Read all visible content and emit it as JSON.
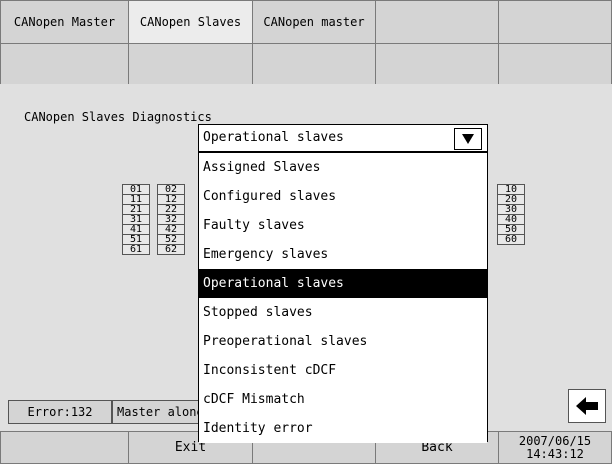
{
  "tabs": [
    {
      "label": "CANopen Master",
      "active": false
    },
    {
      "label": "CANopen Slaves",
      "active": true
    },
    {
      "label": "CANopen master",
      "active": false
    },
    {
      "label": "",
      "active": false
    },
    {
      "label": "",
      "active": false
    }
  ],
  "section_title": "CANopen Slaves Diagnostics",
  "dropdown": {
    "selected": "Operational slaves",
    "options": [
      "Assigned Slaves",
      "Configured slaves",
      "Faulty slaves",
      "Emergency slaves",
      "Operational slaves",
      "Stopped slaves",
      "Preoperational slaves",
      "Inconsistent cDCF",
      "cDCF Mismatch",
      "Identity error"
    ],
    "highlighted_index": 4
  },
  "node_grid": {
    "col1": [
      "01",
      "11",
      "21",
      "31",
      "41",
      "51",
      "61"
    ],
    "col2": [
      "02",
      "12",
      "22",
      "32",
      "42",
      "52",
      "62"
    ],
    "col10": [
      "10",
      "20",
      "30",
      "40",
      "50",
      "60"
    ]
  },
  "status": {
    "error": "Error:132",
    "message": "Master alone"
  },
  "bottom": {
    "exit_label": "Exit",
    "back_label": "Back",
    "date": "2007/06/15",
    "time": "14:43:12"
  },
  "icons": {
    "back_arrow": "arrow-left-icon",
    "dropdown": "triangle-down-icon"
  }
}
